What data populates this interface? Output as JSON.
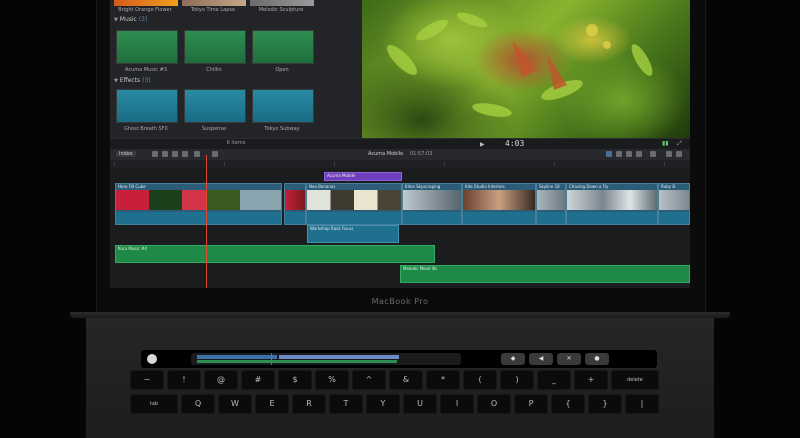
{
  "device": {
    "label": "MacBook Pro"
  },
  "browser": {
    "top_row_labels": [
      "Bright Orange Flower",
      "Tokyo Time Lapse",
      "Melodic Sculpture"
    ],
    "sections": [
      {
        "name": "Music",
        "count": "(3)",
        "items": [
          "Acuma Music #3",
          "Chillin",
          "Open"
        ]
      },
      {
        "name": "Effects",
        "count": "(3)",
        "items": [
          "Ghost Breath SFX",
          "Suspense",
          "Tokyo Subway"
        ]
      }
    ],
    "item_count": "6 items"
  },
  "viewer": {
    "timecode": "4:03"
  },
  "timeline": {
    "index_label": "Index",
    "project_name": "Acuma Mobile",
    "project_duration": "01:57:03",
    "connected_title": "Acuma Mobile",
    "clips": [
      "Hero Fill Cube",
      "Neo Bananas",
      "Kites Skyscraping",
      "Kite Studio Interiors",
      "Skyline 18",
      "Chasing Down a Fly",
      "Ruby B"
    ],
    "connected_clip": "Workshop Rack Focus",
    "audio_tracks": [
      "Kuru Music #4",
      "Melodic Mood 4b"
    ]
  },
  "keyboard": {
    "number_row": [
      "~",
      "!",
      "@",
      "#",
      "$",
      "%",
      "^",
      "&",
      "*",
      "(",
      ")",
      "_",
      "+",
      "delete"
    ],
    "qwerty_row": [
      "tab",
      "Q",
      "W",
      "E",
      "R",
      "T",
      "Y",
      "U",
      "I",
      "O",
      "P",
      "{",
      "}",
      "|"
    ]
  },
  "colors": {
    "accent_purple": "#6d3fbf",
    "clip_blue": "#2b5c78",
    "audio_green": "#1f8a48",
    "playhead": "#e0452f"
  }
}
